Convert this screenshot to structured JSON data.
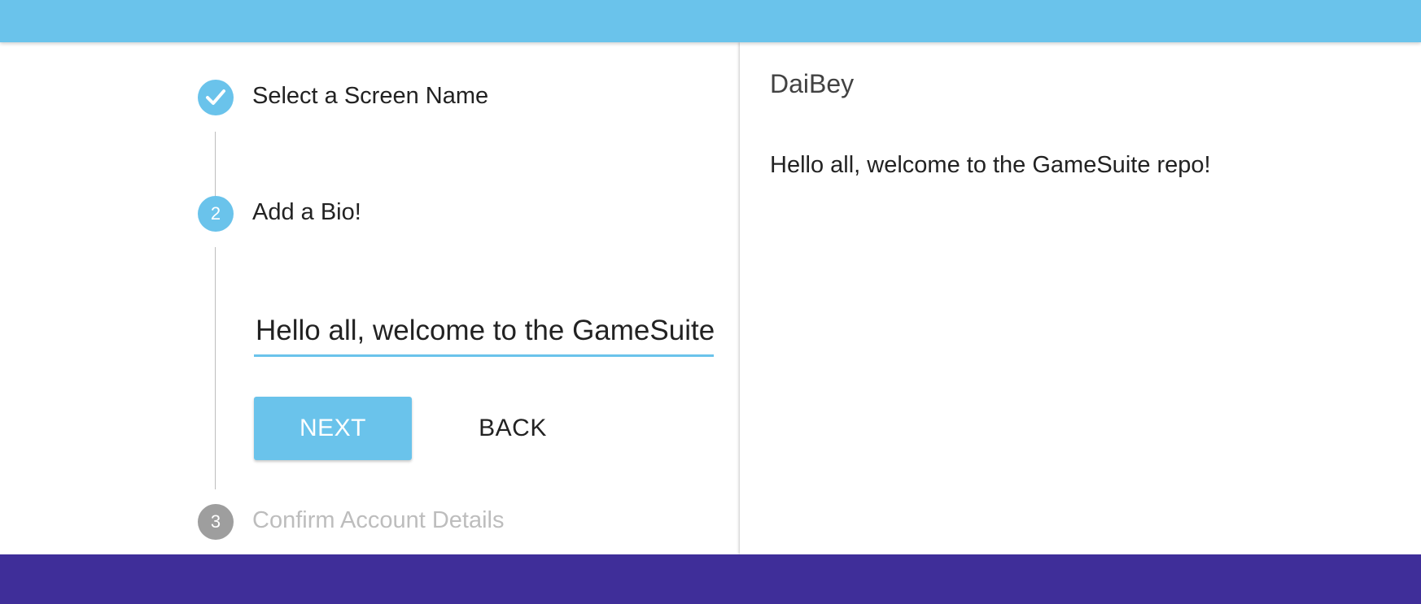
{
  "theme": {
    "primary": "#6ac3eb",
    "footer": "#3f2e99",
    "pending": "#9e9e9e"
  },
  "stepper": {
    "steps": [
      {
        "index": "1",
        "label": "Select a Screen Name",
        "state": "completed",
        "icon": "check-icon"
      },
      {
        "index": "2",
        "label": "Add a Bio!",
        "state": "active"
      },
      {
        "index": "3",
        "label": "Confirm Account Details",
        "state": "pending"
      }
    ],
    "bio_input": {
      "value": "Hello all, welcome to the GameSuite repo!"
    },
    "next_label": "NEXT",
    "back_label": "BACK"
  },
  "preview": {
    "screen_name": "DaiBey",
    "bio": "Hello all, welcome to the GameSuite repo!"
  }
}
